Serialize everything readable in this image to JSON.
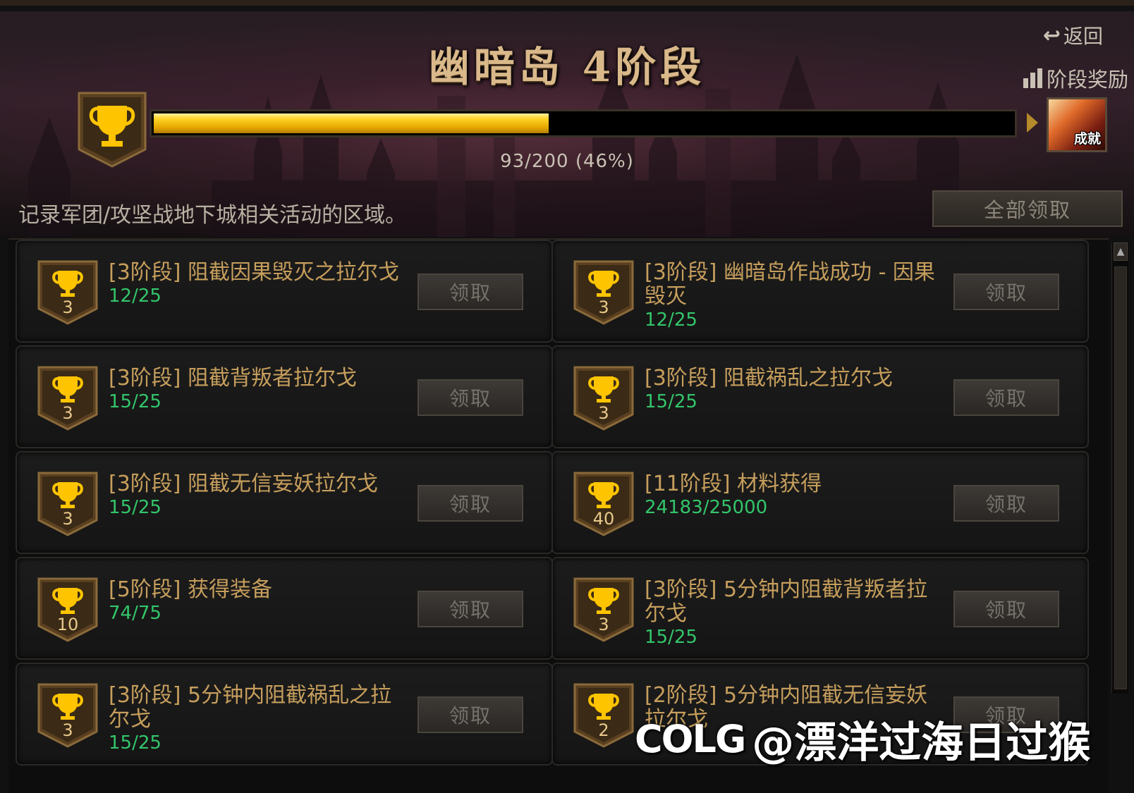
{
  "header": {
    "title": "幽暗岛  4阶段",
    "back_label": "返回",
    "stage_reward_label": "阶段奖励",
    "progress_text": "93/200 (46%)",
    "progress_value": 93,
    "progress_max": 200,
    "progress_fraction": 0.46,
    "reward_label": "成就",
    "description": "记录军团/攻坚战地下城相关活动的区域。",
    "claim_all_label": "全部领取"
  },
  "cards": [
    {
      "title": "[3阶段] 阻截因果毁灭之拉尔戈",
      "progress": "12/25",
      "badge": "3",
      "button": "领取"
    },
    {
      "title": "[3阶段] 幽暗岛作战成功 - 因果毁灭",
      "progress": "12/25",
      "badge": "3",
      "button": "领取"
    },
    {
      "title": "[3阶段] 阻截背叛者拉尔戈",
      "progress": "15/25",
      "badge": "3",
      "button": "领取"
    },
    {
      "title": "[3阶段] 阻截祸乱之拉尔戈",
      "progress": "15/25",
      "badge": "3",
      "button": "领取"
    },
    {
      "title": "[3阶段] 阻截无信妄妖拉尔戈",
      "progress": "15/25",
      "badge": "3",
      "button": "领取"
    },
    {
      "title": "[11阶段] 材料获得",
      "progress": "24183/25000",
      "badge": "40",
      "button": "领取"
    },
    {
      "title": "[5阶段] 获得装备",
      "progress": "74/75",
      "badge": "10",
      "button": "领取"
    },
    {
      "title": "[3阶段] 5分钟内阻截背叛者拉尔戈",
      "progress": "15/25",
      "badge": "3",
      "button": "领取"
    },
    {
      "title": "[3阶段] 5分钟内阻截祸乱之拉尔戈",
      "progress": "15/25",
      "badge": "3",
      "button": "领取"
    },
    {
      "title": "[2阶段] 5分钟内阻截无信妄妖拉尔戈",
      "progress": "",
      "badge": "2",
      "button": "领取"
    }
  ],
  "watermark": {
    "logo": "COLG",
    "text": "@漂洋过海日过猴"
  },
  "colors": {
    "title_gold": "#d9b88a",
    "card_title": "#c69e5c",
    "progress_green": "#33c56a",
    "bar_yellow": "#ffd52a"
  }
}
